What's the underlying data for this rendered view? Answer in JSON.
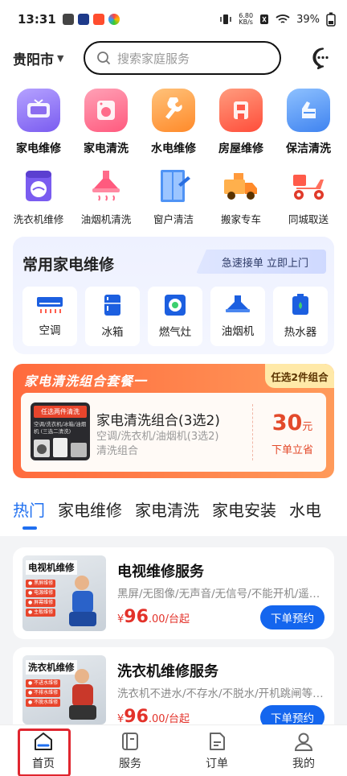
{
  "status_bar": {
    "time": "13:31",
    "net_speed_value": "6.80",
    "net_speed_unit": "KB/s",
    "battery": "39%"
  },
  "header": {
    "city": "贵阳市",
    "search_placeholder": "搜索家庭服务"
  },
  "categories_primary": [
    {
      "label": "家电维修",
      "icon": "tv-repair-icon",
      "color": "#8b6cf0"
    },
    {
      "label": "家电清洗",
      "icon": "washing-clean-icon",
      "color": "#ff6b8a"
    },
    {
      "label": "水电维修",
      "icon": "wrench-icon",
      "color": "#ff9a3c"
    },
    {
      "label": "房屋维修",
      "icon": "house-repair-icon",
      "color": "#ff5b4a"
    },
    {
      "label": "保洁清洗",
      "icon": "cleaning-icon",
      "color": "#4f93f5"
    }
  ],
  "categories_secondary": [
    {
      "label": "洗衣机维修",
      "icon": "washing-machine-icon"
    },
    {
      "label": "油烟机清洗",
      "icon": "range-hood-icon"
    },
    {
      "label": "窗户清洁",
      "icon": "window-clean-icon"
    },
    {
      "label": "搬家专车",
      "icon": "moving-truck-icon"
    },
    {
      "label": "同城取送",
      "icon": "delivery-scooter-icon"
    }
  ],
  "common_repair": {
    "title": "常用家电维修",
    "quick_tag": "急速接单 立即上门",
    "items": [
      {
        "label": "空调",
        "icon": "air-conditioner-icon"
      },
      {
        "label": "冰箱",
        "icon": "fridge-icon"
      },
      {
        "label": "燃气灶",
        "icon": "gas-stove-icon"
      },
      {
        "label": "油烟机",
        "icon": "range-hood-icon"
      },
      {
        "label": "热水器",
        "icon": "water-heater-icon"
      }
    ]
  },
  "combo": {
    "banner_title": "家电清洗组合套餐一",
    "badge": "任选2件组合",
    "thumb_title": "任选两件清洗",
    "thumb_sub": "空调/洗衣机/冰箱/油烟机 (三选二清洗)",
    "name": "家电清洗组合(3选2)",
    "desc_line1": "空调/洗衣机/油烟机(3选2)",
    "desc_line2": "清洗组合",
    "price": "30",
    "price_unit": "元",
    "cta": "下单立省"
  },
  "tabs": [
    "热门",
    "家电维修",
    "家电清洗",
    "家电安装",
    "水电"
  ],
  "services": [
    {
      "thumb_label": "电视机维修",
      "thumb_lines": [
        "● 黑屏维修",
        "● 电源维修",
        "● 屏幕维修",
        "● 主板维修"
      ],
      "title": "电视维修服务",
      "desc": "黑屏/无图像/无声音/无信号/不能开机/遥控器失灵",
      "currency": "¥",
      "price": "96",
      "price_suffix": ".00/台起",
      "button": "下单预约"
    },
    {
      "thumb_label": "洗衣机维修",
      "thumb_lines": [
        "● 不进水维修",
        "● 不排水维修",
        "● 不脱水维修"
      ],
      "title": "洗衣机维修服务",
      "desc": "洗衣机不进水/不存水/不脱水/开机跳闸等故障",
      "currency": "¥",
      "price": "96",
      "price_suffix": ".00/台起",
      "button": "下单预约"
    }
  ],
  "bottom_nav": [
    {
      "label": "首页",
      "icon": "home-icon"
    },
    {
      "label": "服务",
      "icon": "service-icon"
    },
    {
      "label": "订单",
      "icon": "order-icon"
    },
    {
      "label": "我的",
      "icon": "profile-icon"
    }
  ]
}
